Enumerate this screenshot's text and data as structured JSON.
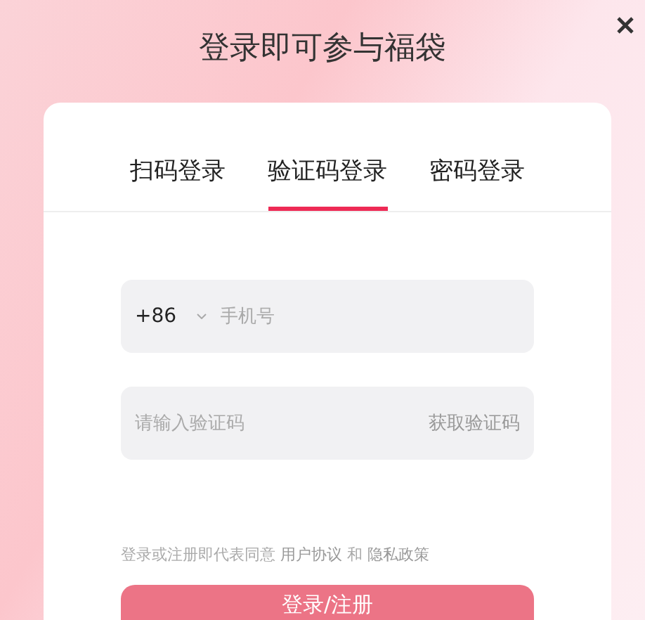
{
  "title": "登录即可参与福袋",
  "tabs": [
    {
      "label": "扫码登录",
      "selected": false
    },
    {
      "label": "验证码登录",
      "selected": true
    },
    {
      "label": "密码登录",
      "selected": false
    }
  ],
  "phone": {
    "country_code": "+86",
    "placeholder": "手机号"
  },
  "code": {
    "placeholder": "请输入验证码",
    "action": "获取验证码"
  },
  "agreement": {
    "text": "登录或注册即代表同意",
    "links": [
      "用户协议",
      "隐私政策"
    ],
    "joiner": "和"
  },
  "submit": {
    "label": "登录/注册",
    "disabled": true
  }
}
